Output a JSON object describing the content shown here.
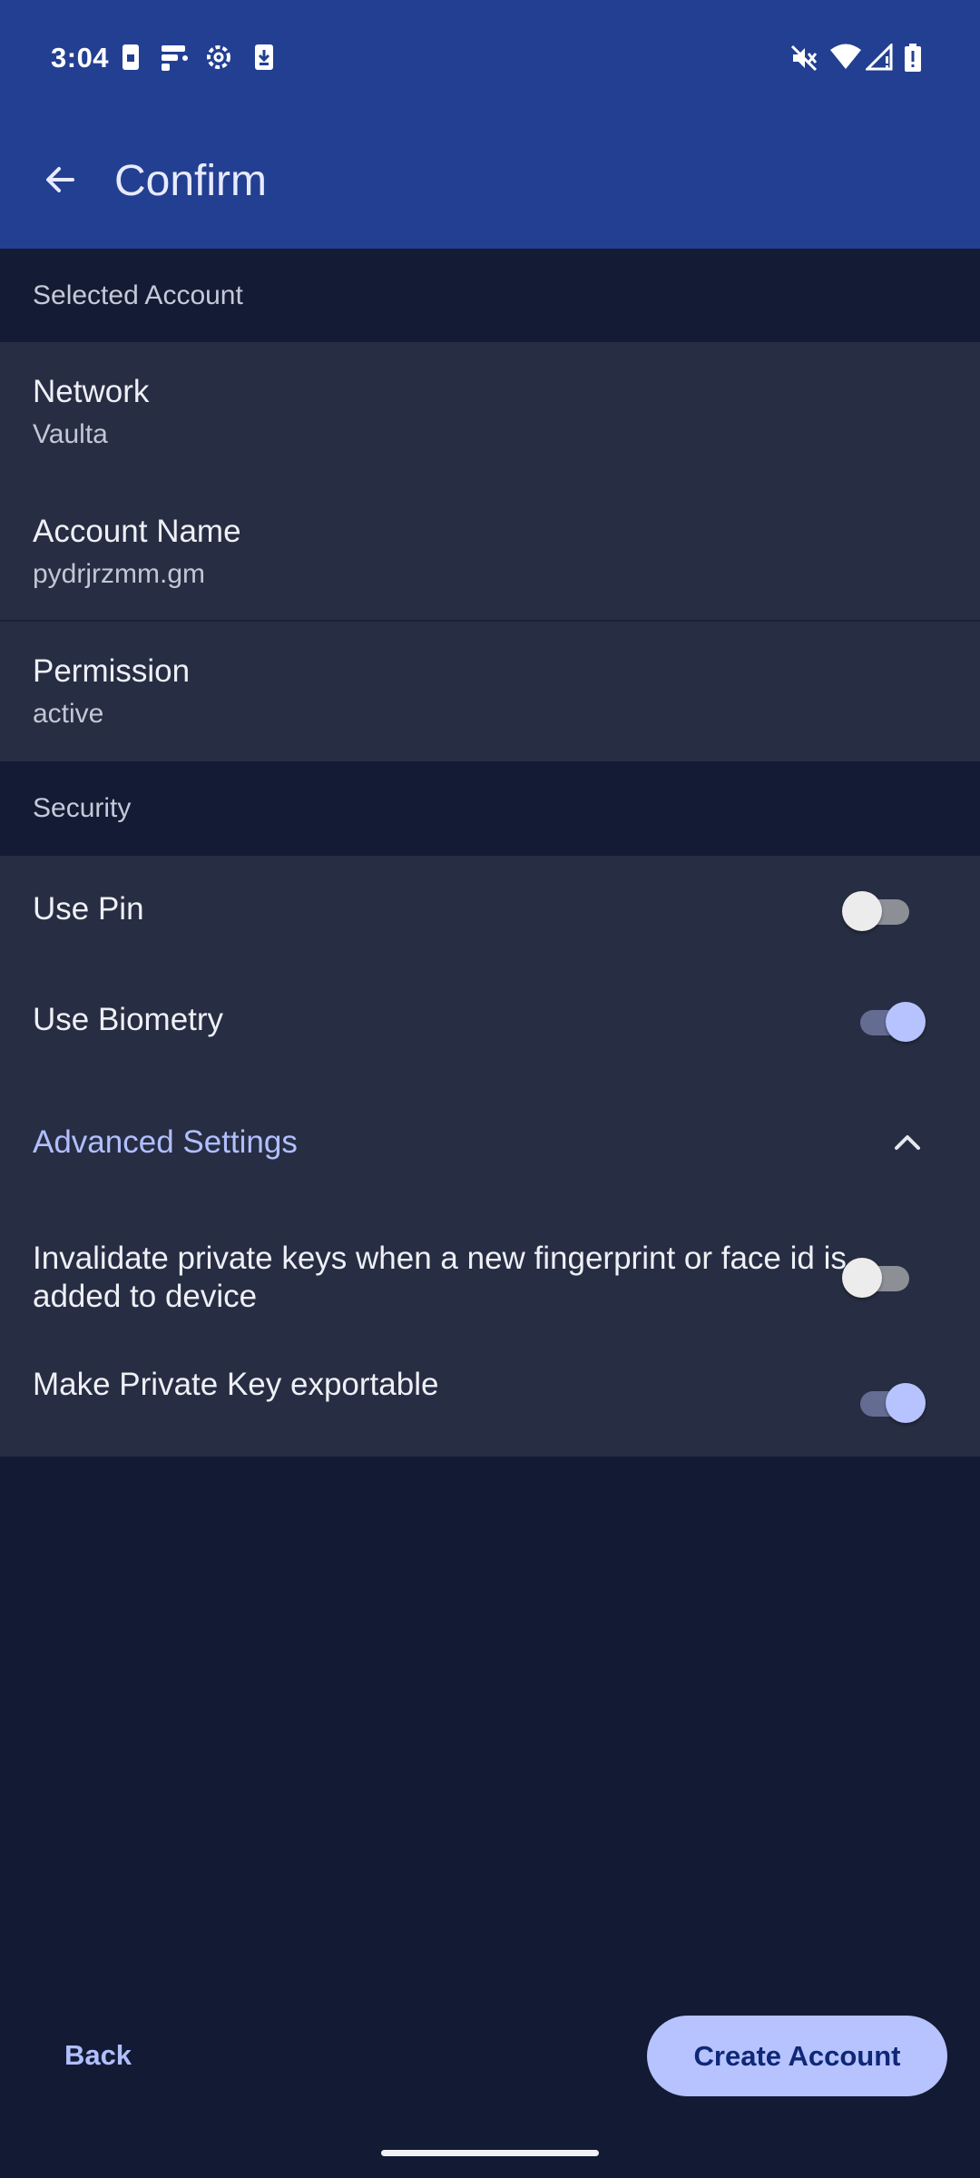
{
  "status_bar": {
    "time": "3:04",
    "left_icons": [
      "sim-card-icon",
      "app-notification-icon",
      "settings-gear-icon",
      "download-icon"
    ],
    "right_icons": [
      "mute-icon",
      "wifi-icon",
      "cellular-signal-icon",
      "battery-alert-icon"
    ]
  },
  "toolbar": {
    "title": "Confirm",
    "back_icon": "arrow-back-icon"
  },
  "sections": {
    "selected_account": "Selected Account",
    "security": "Security"
  },
  "account": {
    "network_label": "Network",
    "network_value": "Vaulta",
    "name_label": "Account Name",
    "name_value": "pydrjrzmm.gm",
    "permission_label": "Permission",
    "permission_value": "active"
  },
  "security": {
    "use_pin": {
      "label": "Use Pin",
      "enabled": false
    },
    "use_biometry": {
      "label": "Use Biometry",
      "enabled": true
    },
    "advanced": {
      "label": "Advanced Settings",
      "expanded": true,
      "chevron": "chevron-up-icon"
    },
    "invalidate_keys": {
      "label": "Invalidate private keys when a new fingerprint or face id is added to device",
      "enabled": false
    },
    "exportable": {
      "label": "Make Private Key exportable",
      "enabled": true
    }
  },
  "actions": {
    "back_label": "Back",
    "create_label": "Create Account"
  },
  "colors": {
    "app_bar": "#233f92",
    "background": "#131a33",
    "panel": "#272d42",
    "accent": "#b6c3ff"
  }
}
